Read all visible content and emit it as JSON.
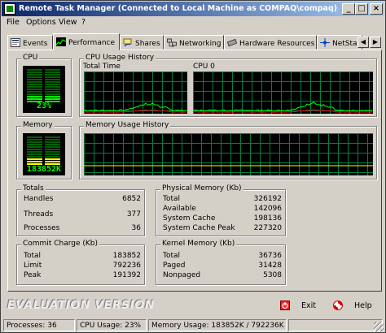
{
  "window": {
    "title": "Remote Task Manager (Connected to Local Machine as COMPAQ\\compaq)"
  },
  "menu": [
    "File",
    "Options",
    "View",
    "?"
  ],
  "title_buttons": {
    "minimize": "_",
    "maximize": "□",
    "close": "×"
  },
  "tabs": [
    {
      "label": "Events",
      "icon": "events-icon",
      "active": false
    },
    {
      "label": "Performance",
      "icon": "performance-icon",
      "active": true
    },
    {
      "label": "Shares",
      "icon": "shares-icon",
      "active": false
    },
    {
      "label": "Networking",
      "icon": "networking-icon",
      "active": false
    },
    {
      "label": "Hardware Resources",
      "icon": "hardware-icon",
      "active": false
    },
    {
      "label": "NetStat",
      "icon": "netstat-icon",
      "active": false
    }
  ],
  "performance": {
    "cpu": {
      "label": "CPU",
      "value_text": "23%",
      "usage_fraction": 0.23
    },
    "cpu_history": {
      "label": "CPU Usage History",
      "panes": [
        "Total Time",
        "CPU 0"
      ]
    },
    "memory": {
      "label": "Memory",
      "value_text": "183852K",
      "usage_fraction": 0.23
    },
    "memory_history": {
      "label": "Memory Usage History",
      "usage_fraction": 0.23
    }
  },
  "totals": {
    "label": "Totals",
    "rows": [
      {
        "k": "Handles",
        "v": "6852"
      },
      {
        "k": "Threads",
        "v": "377"
      },
      {
        "k": "Processes",
        "v": "36"
      }
    ]
  },
  "physical_memory": {
    "label": "Physical Memory (Kb)",
    "rows": [
      {
        "k": "Total",
        "v": "326192"
      },
      {
        "k": "Available",
        "v": "142096"
      },
      {
        "k": "System Cache",
        "v": "198136"
      },
      {
        "k": "System Cache Peak",
        "v": "227320"
      }
    ]
  },
  "commit_charge": {
    "label": "Commit Charge (Kb)",
    "rows": [
      {
        "k": "Total",
        "v": "183852"
      },
      {
        "k": "Limit",
        "v": "792236"
      },
      {
        "k": "Peak",
        "v": "191392"
      }
    ]
  },
  "kernel_memory": {
    "label": "Kernel Memory (Kb)",
    "rows": [
      {
        "k": "Total",
        "v": "36736"
      },
      {
        "k": "Paged",
        "v": "31428"
      },
      {
        "k": "Nonpaged",
        "v": "5308"
      }
    ]
  },
  "footer": {
    "evaluation": "EVALUATION VERSION",
    "exit_label": "Exit",
    "help_label": "Help"
  },
  "status": {
    "processes": "Processes: 36",
    "cpu": "CPU Usage: 23%",
    "memory": "Memory Usage: 183852K / 792236K"
  },
  "colors": {
    "graph_grid": "#008040",
    "graph_line": "#00ff00",
    "cpu_kernel_line": "#ff0000",
    "memory_line": "#ffff00",
    "title_start": "#0a246a",
    "title_end": "#a6caf0"
  }
}
